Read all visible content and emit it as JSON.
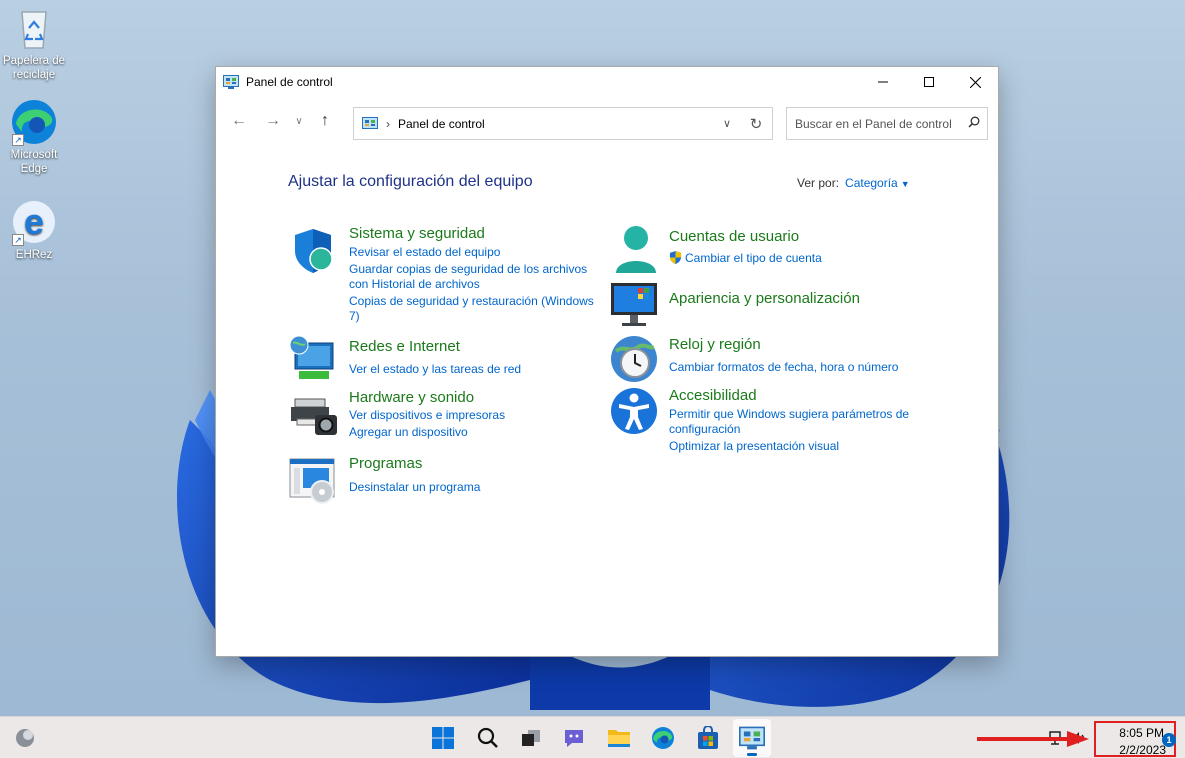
{
  "desktop": {
    "icons": [
      {
        "label": "Papelera de reciclaje",
        "icon": "recycle-bin-icon"
      },
      {
        "label": "Microsoft Edge",
        "icon": "edge-icon"
      },
      {
        "label": "EHRez",
        "icon": "ie-icon"
      }
    ]
  },
  "window": {
    "title": "Panel de control",
    "address": "Panel de control",
    "search_placeholder": "Buscar en el Panel de control",
    "heading": "Ajustar la configuración del equipo",
    "view_by_label": "Ver por:",
    "view_by_value": "Categoría",
    "categories": [
      {
        "title": "Sistema y seguridad",
        "links": [
          "Revisar el estado del equipo",
          "Guardar copias de seguridad de los archivos",
          "con Historial de archivos",
          "Copias de seguridad y restauración (Windows",
          "7)"
        ]
      },
      {
        "title": "Redes e Internet",
        "links": [
          "Ver el estado y las tareas de red"
        ]
      },
      {
        "title": "Hardware y sonido",
        "links": [
          "Ver dispositivos e impresoras",
          "Agregar un dispositivo"
        ]
      },
      {
        "title": "Programas",
        "links": [
          "Desinstalar un programa"
        ]
      },
      {
        "title": "Cuentas de usuario",
        "links": [
          "Cambiar el tipo de cuenta"
        ]
      },
      {
        "title": "Apariencia y personalización",
        "links": []
      },
      {
        "title": "Reloj y región",
        "links": [
          "Cambiar formatos de fecha, hora o número"
        ]
      },
      {
        "title": "Accesibilidad",
        "links": [
          "Permitir que Windows sugiera parámetros de",
          "configuración",
          "Optimizar la presentación visual"
        ]
      }
    ]
  },
  "taskbar": {
    "apps": [
      "widgets-icon",
      "start-icon",
      "search-icon",
      "task-view-icon",
      "chat-icon",
      "file-explorer-icon",
      "edge-icon",
      "store-icon",
      "control-panel-icon"
    ],
    "time": "8:05 PM",
    "date": "2/2/2023",
    "notifications": "1"
  },
  "colors": {
    "accent": "#0067c0",
    "link": "#0066cc",
    "category_title": "#1a7a1a",
    "heading": "#1e3287",
    "highlight": "#e02020"
  }
}
